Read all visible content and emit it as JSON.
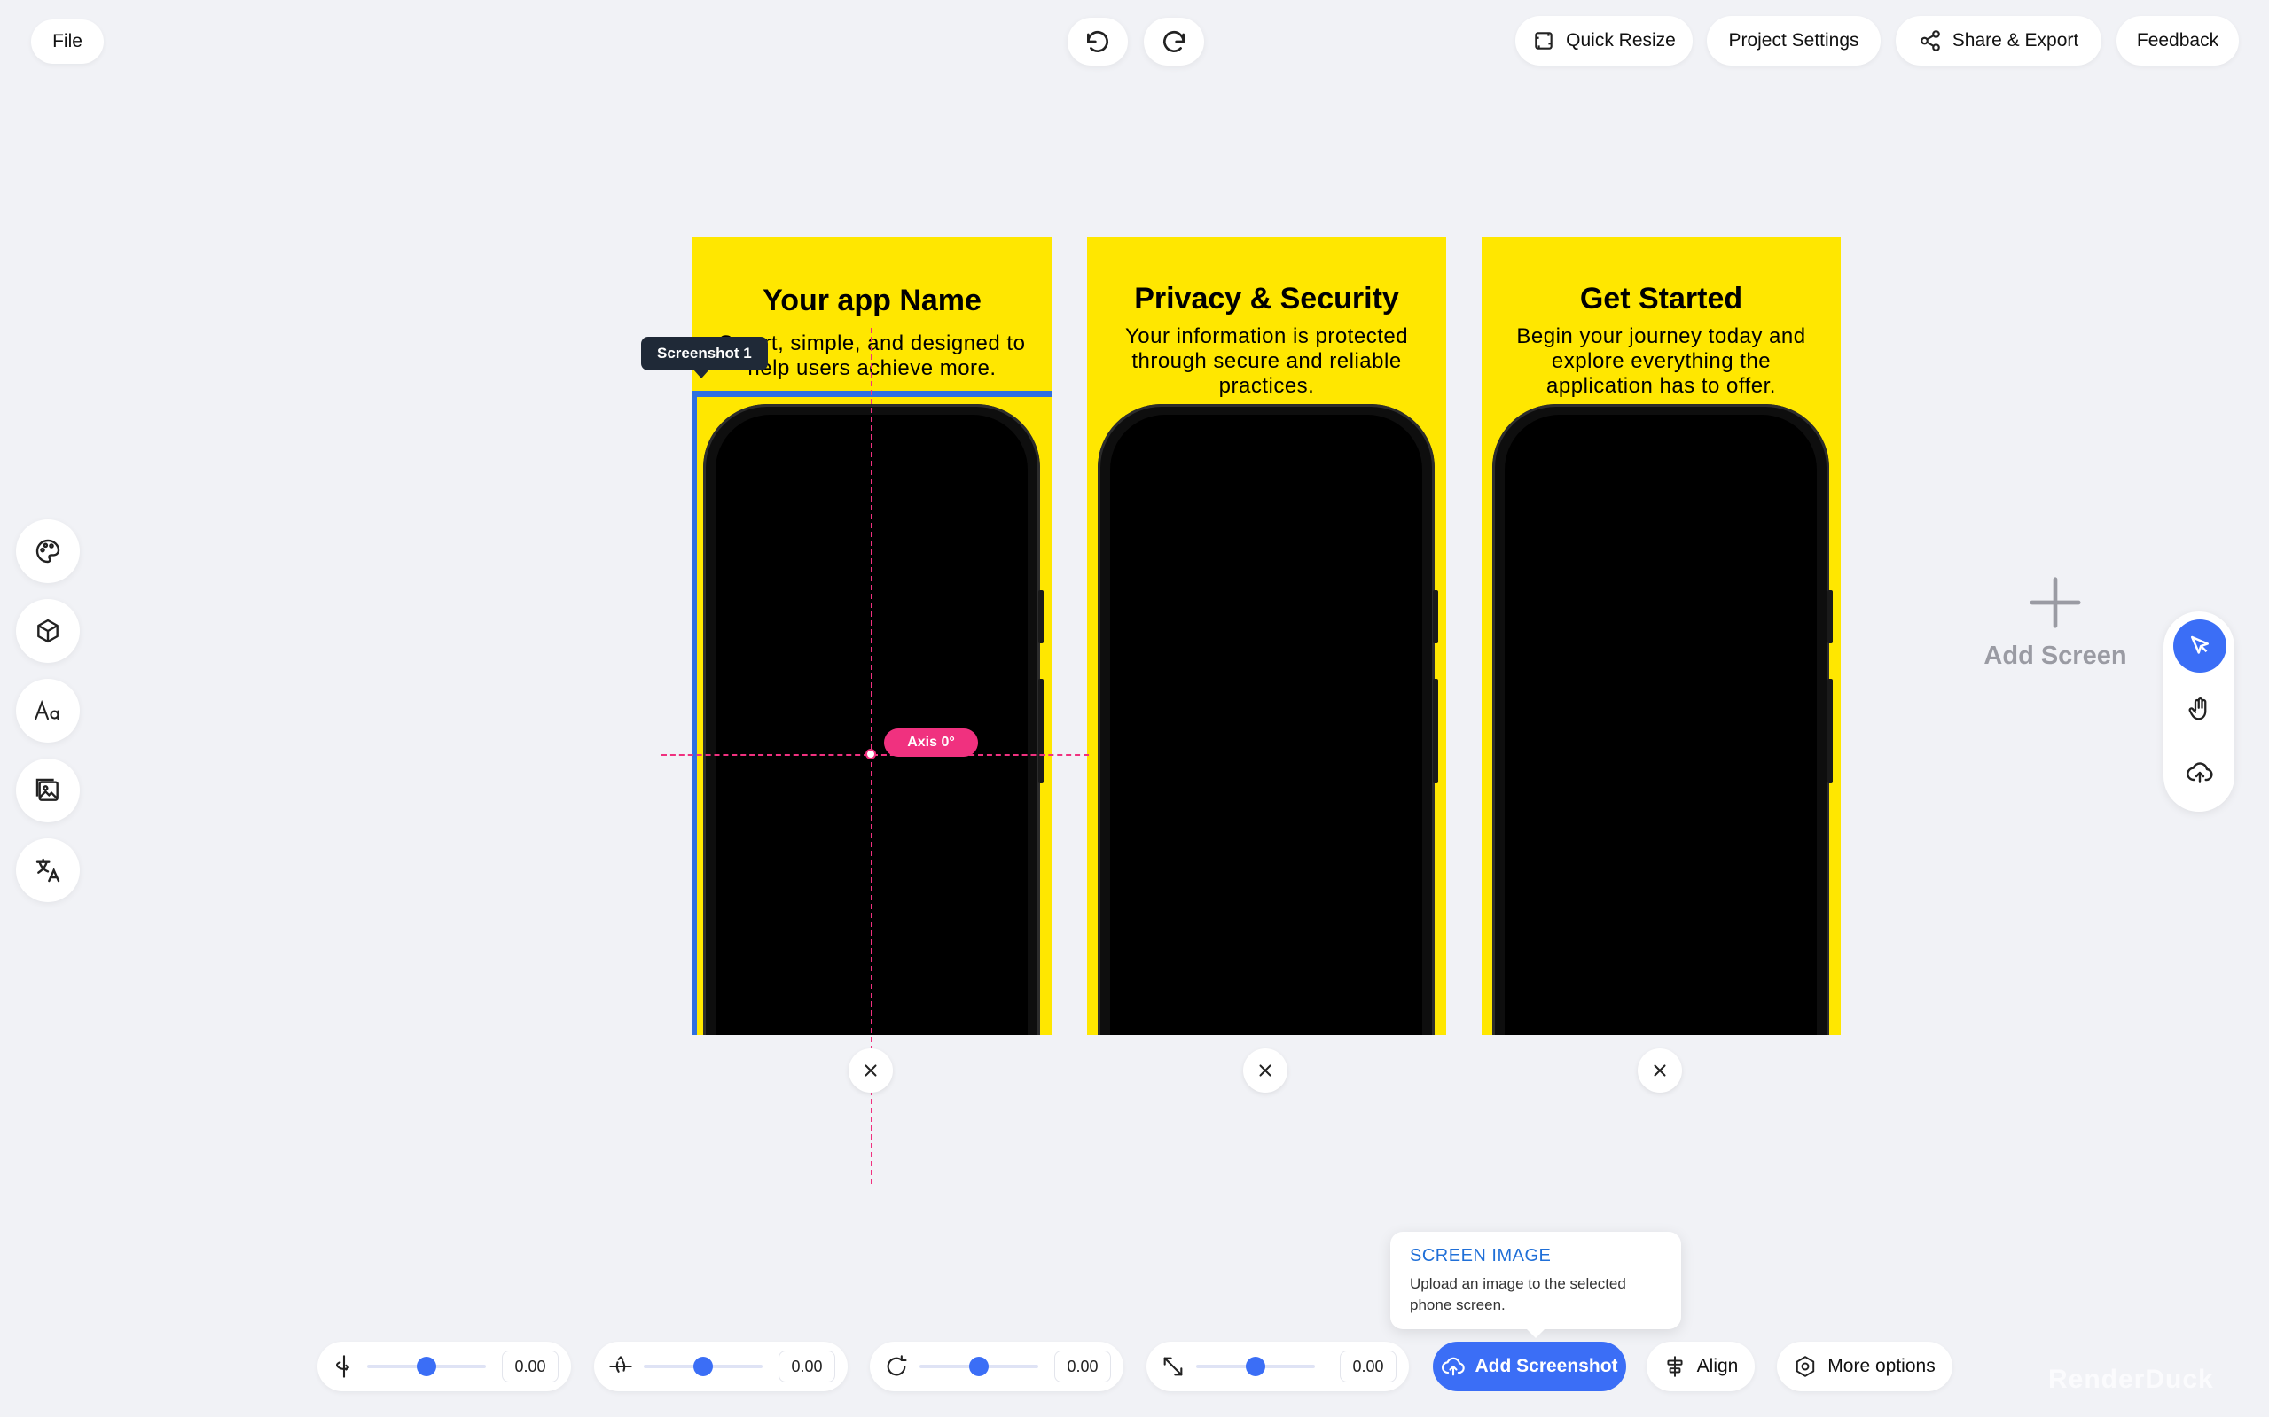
{
  "header": {
    "file_label": "File",
    "quick_resize_label": "Quick Resize",
    "project_settings_label": "Project Settings",
    "share_export_label": "Share & Export",
    "feedback_label": "Feedback"
  },
  "screens": [
    {
      "title": "Your app Name",
      "description": "Smart, simple, and designed to help users achieve more."
    },
    {
      "title": "Privacy & Security",
      "description": "Your information is protected through secure and reliable practices."
    },
    {
      "title": "Get Started",
      "description": "Begin your journey today and explore everything the application has to offer."
    }
  ],
  "selection": {
    "tooltip": "Screenshot 1",
    "axis_label": "Axis 0°"
  },
  "add_screen_label": "Add Screen",
  "sliders": [
    {
      "icon": "tilt-icon",
      "value": "0.00"
    },
    {
      "icon": "rotate-y-icon",
      "value": "0.00"
    },
    {
      "icon": "rotate-icon",
      "value": "0.00"
    },
    {
      "icon": "scale-icon",
      "value": "0.00"
    }
  ],
  "bottom_bar": {
    "add_screenshot_label": "Add Screenshot",
    "align_label": "Align",
    "more_options_label": "More options"
  },
  "popover": {
    "title": "SCREEN IMAGE",
    "body": "Upload an image to the selected phone screen."
  },
  "watermark": "RenderDuck",
  "colors": {
    "accent": "#3b6ef6",
    "guide": "#f0317f",
    "card_background": "#ffe700",
    "selection_outline": "#2f6fe0"
  }
}
